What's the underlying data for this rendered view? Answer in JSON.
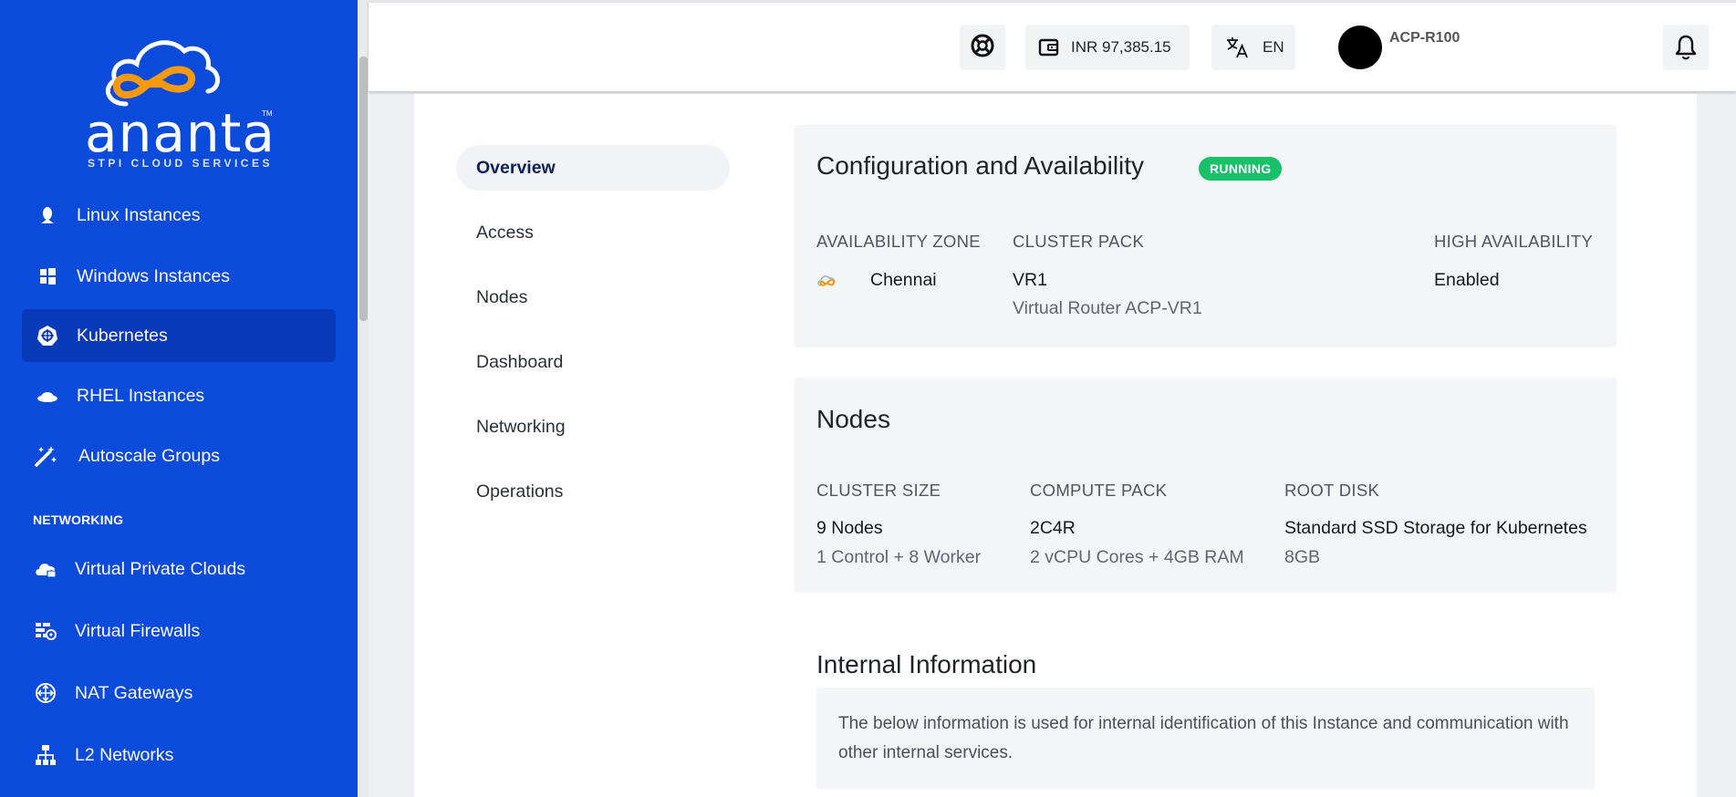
{
  "brand": {
    "name": "ananta",
    "tagline": "STPI CLOUD SERVICES",
    "tm": "TM",
    "primary_color": "#0a4bdb"
  },
  "sidebar": {
    "items": [
      {
        "label": "Linux Instances",
        "icon": "linux-icon"
      },
      {
        "label": "Windows Instances",
        "icon": "windows-icon"
      },
      {
        "label": "Kubernetes",
        "icon": "kubernetes-icon",
        "active": true
      },
      {
        "label": "RHEL Instances",
        "icon": "redhat-icon"
      },
      {
        "label": "Autoscale Groups",
        "icon": "magic-wand-icon"
      }
    ],
    "section_networking": "NETWORKING",
    "networking_items": [
      {
        "label": "Virtual Private Clouds",
        "icon": "cloud-lock-icon"
      },
      {
        "label": "Virtual Firewalls",
        "icon": "firewall-icon"
      },
      {
        "label": "NAT Gateways",
        "icon": "nat-gateway-icon"
      },
      {
        "label": "L2 Networks",
        "icon": "network-tree-icon"
      }
    ]
  },
  "header": {
    "wallet_balance": "INR 97,385.15",
    "language": "EN",
    "account_name": "ACP-R100"
  },
  "tabs": [
    "Overview",
    "Access",
    "Nodes",
    "Dashboard",
    "Networking",
    "Operations"
  ],
  "config": {
    "title": "Configuration and Availability",
    "status": "RUNNING",
    "status_color": "#18c06a",
    "az_label": "AVAILABILITY ZONE",
    "az_value": "Chennai",
    "pack_label": "CLUSTER PACK",
    "pack_value": "VR1",
    "pack_sub": "Virtual Router ACP-VR1",
    "ha_label": "HIGH AVAILABILITY",
    "ha_value": "Enabled"
  },
  "nodes": {
    "title": "Nodes",
    "size_label": "CLUSTER SIZE",
    "size_value": "9 Nodes",
    "size_sub": "1 Control + 8 Worker",
    "compute_label": "COMPUTE PACK",
    "compute_value": "2C4R",
    "compute_sub": "2 vCPU Cores + 4GB RAM",
    "disk_label": "ROOT DISK",
    "disk_value": "Standard SSD Storage for Kubernetes",
    "disk_sub": "8GB"
  },
  "internal": {
    "title": "Internal Information",
    "description": "The below information is used for internal identification of this Instance and communication with other internal services."
  }
}
